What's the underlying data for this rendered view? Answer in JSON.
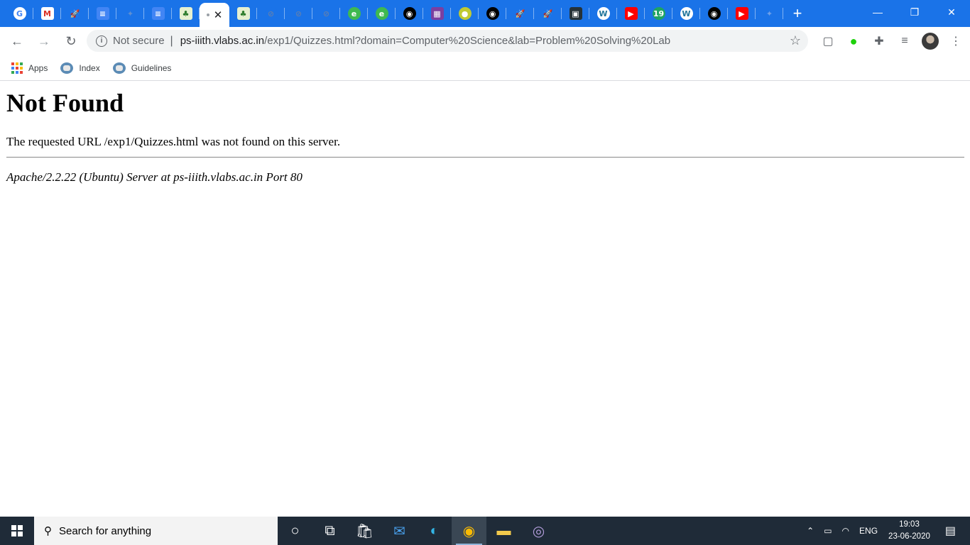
{
  "browser": {
    "tabs": [
      {
        "icon": "google-icon",
        "color": "#ffffff",
        "glyph": "G",
        "fg": "#4285f4"
      },
      {
        "icon": "gmail-icon",
        "color": "#ffffff",
        "glyph": "M",
        "fg": "#d93025"
      },
      {
        "icon": "rocket-icon",
        "color": "#1a73e8",
        "glyph": "🚀",
        "fg": "#ffffff"
      },
      {
        "icon": "docs-icon",
        "color": "#4285f4",
        "glyph": "≡",
        "fg": "#ffffff"
      },
      {
        "icon": "generic-icon",
        "color": "#1a73e8",
        "glyph": "✦",
        "fg": "#5f8fd0"
      },
      {
        "icon": "docs-icon",
        "color": "#4285f4",
        "glyph": "≡",
        "fg": "#ffffff"
      },
      {
        "icon": "vlabs-icon",
        "color": "#e6f0d0",
        "glyph": "♣",
        "fg": "#2a7a2a"
      }
    ],
    "active_tab": {
      "close": "✕"
    },
    "tabs_after": [
      {
        "icon": "vlabs-icon",
        "color": "#e6f0d0",
        "glyph": "♣",
        "fg": "#2a7a2a"
      },
      {
        "icon": "blocked-icon",
        "color": "#1a73e8",
        "glyph": "⊘",
        "fg": "#5f7fb0"
      },
      {
        "icon": "blocked-icon",
        "color": "#1a73e8",
        "glyph": "⊘",
        "fg": "#5f7fb0"
      },
      {
        "icon": "blocked-icon",
        "color": "#1a73e8",
        "glyph": "⊘",
        "fg": "#5f7fb0"
      },
      {
        "icon": "edge-icon",
        "color": "#3fb950",
        "glyph": "e",
        "fg": "#ffffff"
      },
      {
        "icon": "edge-icon",
        "color": "#3fb950",
        "glyph": "e",
        "fg": "#ffffff"
      },
      {
        "icon": "github-icon",
        "color": "#000000",
        "glyph": "◉",
        "fg": "#ffffff"
      },
      {
        "icon": "purple-icon",
        "color": "#7b3fa0",
        "glyph": "▦",
        "fg": "#ffffff"
      },
      {
        "icon": "lime-icon",
        "color": "#c0ca33",
        "glyph": "●",
        "fg": "#ffffff"
      },
      {
        "icon": "github-icon",
        "color": "#000000",
        "glyph": "◉",
        "fg": "#ffffff"
      },
      {
        "icon": "rocket-icon",
        "color": "#1a73e8",
        "glyph": "🚀",
        "fg": "#ffffff"
      },
      {
        "icon": "rocket-icon",
        "color": "#1a73e8",
        "glyph": "🚀",
        "fg": "#ffffff"
      },
      {
        "icon": "app-icon",
        "color": "#263238",
        "glyph": "▣",
        "fg": "#ffffff"
      },
      {
        "icon": "wordpress-icon",
        "color": "#ffffff",
        "glyph": "W",
        "fg": "#21759b"
      },
      {
        "icon": "youtube-icon",
        "color": "#ff0000",
        "glyph": "▶",
        "fg": "#ffffff"
      },
      {
        "icon": "nineteen-icon",
        "color": "#1fa463",
        "glyph": "19",
        "fg": "#ffffff"
      },
      {
        "icon": "wordpress-icon",
        "color": "#ffffff",
        "glyph": "W",
        "fg": "#21759b"
      },
      {
        "icon": "github-icon",
        "color": "#000000",
        "glyph": "◉",
        "fg": "#ffffff"
      },
      {
        "icon": "youtube-icon",
        "color": "#ff0000",
        "glyph": "▶",
        "fg": "#ffffff"
      },
      {
        "icon": "generic-icon",
        "color": "#1a73e8",
        "glyph": "✦",
        "fg": "#6fa0e8"
      }
    ],
    "new_tab": "+",
    "window_controls": {
      "minimize": "—",
      "restore": "❐",
      "close": "✕"
    },
    "nav": {
      "back": "←",
      "forward": "→",
      "reload": "↻"
    },
    "omnibox": {
      "info": "i",
      "security_label": "Not secure",
      "separator": "|",
      "url_host": "ps-iiith.vlabs.ac.in",
      "url_path": "/exp1/Quizzes.html?domain=Computer%20Science&lab=Problem%20Solving%20Lab",
      "star": "☆"
    },
    "toolbar_right": {
      "pocket": "▢",
      "ext": "●",
      "puzzle": "✚",
      "media": "≡",
      "menu": "⋮"
    },
    "bookmarks": [
      {
        "label": "Apps"
      },
      {
        "label": "Index"
      },
      {
        "label": "Guidelines"
      }
    ],
    "apps_colors": [
      "#ea4335",
      "#fbbc04",
      "#34a853",
      "#4285f4",
      "#ea4335",
      "#fbbc04",
      "#34a853",
      "#4285f4",
      "#ea4335"
    ]
  },
  "page": {
    "heading": "Not Found",
    "message": "The requested URL /exp1/Quizzes.html was not found on this server.",
    "server_signature": "Apache/2.2.22 (Ubuntu) Server at ps-iiith.vlabs.ac.in Port 80"
  },
  "taskbar": {
    "search_placeholder": "Search for anything",
    "search_icon": "⚲",
    "apps": [
      {
        "name": "cortana-icon",
        "glyph": "○",
        "color": "#ffffff"
      },
      {
        "name": "task-view-icon",
        "glyph": "⧉",
        "color": "#ffffff"
      },
      {
        "name": "store-icon",
        "glyph": "🛍",
        "color": "#ffffff"
      },
      {
        "name": "mail-icon",
        "glyph": "✉",
        "color": "#4aa3f0"
      },
      {
        "name": "edge-icon",
        "glyph": "◐",
        "color": "#33b5e5"
      },
      {
        "name": "chrome-icon",
        "glyph": "◉",
        "color": "#fbbc04"
      },
      {
        "name": "file-explorer-icon",
        "glyph": "▬",
        "color": "#f2c94c"
      },
      {
        "name": "app-icon",
        "glyph": "◎",
        "color": "#b39ddb"
      }
    ],
    "tray": {
      "chevron": "⌃",
      "battery": "▭",
      "wifi": "◠",
      "language": "ENG",
      "time": "19:03",
      "date": "23-06-2020",
      "notifications": "▤"
    }
  }
}
